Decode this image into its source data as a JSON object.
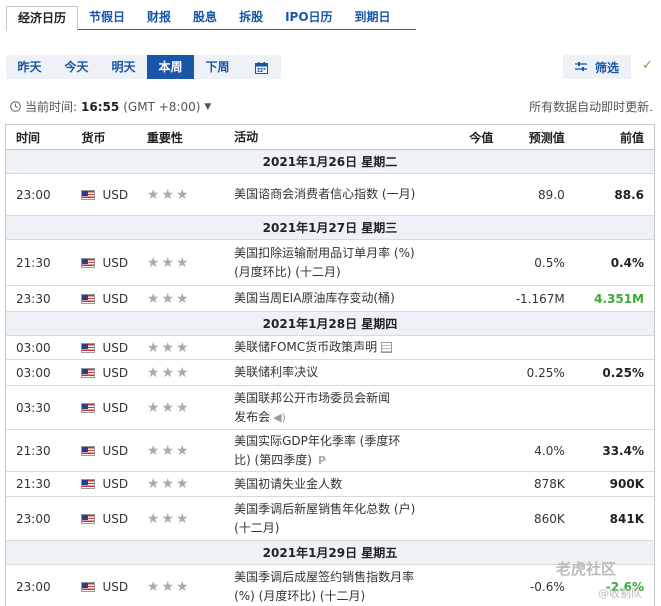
{
  "top_tabs": [
    "经济日历",
    "节假日",
    "财报",
    "股息",
    "拆股",
    "IPO日历",
    "到期日"
  ],
  "period_tabs": [
    "昨天",
    "今天",
    "明天",
    "本周",
    "下周"
  ],
  "filter_label": "筛选",
  "time": {
    "prefix": "当前时间:",
    "value": "16:55",
    "tz": "(GMT +8:00)"
  },
  "auto_note": "所有数据自动即时更新.",
  "columns": {
    "time": "时间",
    "currency": "货币",
    "importance": "重要性",
    "activity": "活动",
    "actual": "今值",
    "forecast": "预测值",
    "previous": "前值"
  },
  "days": [
    {
      "date": "2021年1月26日  星期二",
      "rows": [
        {
          "time": "23:00",
          "cur": "USD",
          "act": "美国谘商会消费者信心指数 (一月)",
          "actual": "",
          "fc": "89.0",
          "prev": "88.6"
        }
      ]
    },
    {
      "date": "2021年1月27日  星期三",
      "rows": [
        {
          "time": "21:30",
          "cur": "USD",
          "act": "美国扣除运输耐用品订单月率 (%) (月度环比) (十二月)",
          "actual": "",
          "fc": "0.5%",
          "prev": "0.4%"
        },
        {
          "time": "23:30",
          "cur": "USD",
          "act": "美国当周EIA原油库存变动(桶)",
          "actual": "",
          "fc": "-1.167M",
          "prev": "4.351M"
        }
      ]
    },
    {
      "date": "2021年1月28日  星期四",
      "rows": [
        {
          "time": "03:00",
          "cur": "USD",
          "act": "美联储FOMC货币政策声明",
          "actual": "",
          "fc": "",
          "prev": ""
        },
        {
          "time": "03:00",
          "cur": "USD",
          "act": "美联储利率决议",
          "actual": "",
          "fc": "0.25%",
          "prev": "0.25%"
        },
        {
          "time": "03:30",
          "cur": "USD",
          "act": "美国联邦公开市场委员会新闻发布会",
          "actual": "",
          "fc": "",
          "prev": ""
        },
        {
          "time": "21:30",
          "cur": "USD",
          "act": "美国实际GDP年化季率 (季度环比) (第四季度)",
          "actual": "",
          "fc": "4.0%",
          "prev": "33.4%"
        },
        {
          "time": "21:30",
          "cur": "USD",
          "act": "美国初请失业金人数",
          "actual": "",
          "fc": "878K",
          "prev": "900K"
        },
        {
          "time": "23:00",
          "cur": "USD",
          "act": "美国季调后新屋销售年化总数 (户) (十二月)",
          "actual": "",
          "fc": "860K",
          "prev": "841K"
        }
      ]
    },
    {
      "date": "2021年1月29日  星期五",
      "rows": [
        {
          "time": "23:00",
          "cur": "USD",
          "act": "美国季调后成屋签约销售指数月率(%) (月度环比) (十二月)",
          "actual": "",
          "fc": "-0.6%",
          "prev": "-2.6%"
        }
      ]
    }
  ],
  "watermark": {
    "line1": "老虎社区",
    "line2": "@收割队"
  }
}
